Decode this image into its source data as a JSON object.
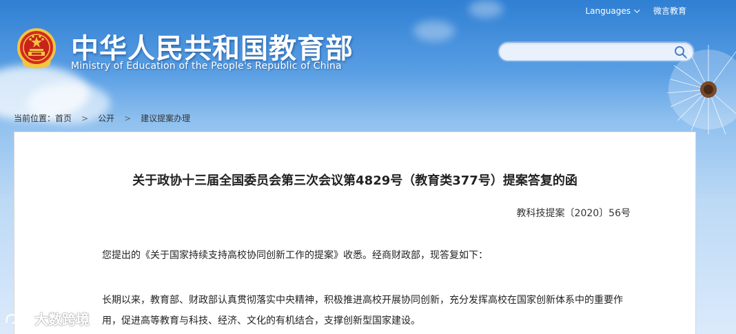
{
  "top_links": {
    "languages": "Languages",
    "weibo": "微言教育"
  },
  "header": {
    "title_cn": "中华人民共和国教育部",
    "title_en": "Ministry of Education of the People's Republic of China"
  },
  "search": {
    "placeholder": "",
    "value": ""
  },
  "breadcrumb": {
    "prefix": "当前位置：",
    "items": [
      "首页",
      "公开",
      "建议提案办理"
    ],
    "separator": ">"
  },
  "document": {
    "title": "关于政协十三届全国委员会第三次会议第4829号（教育类377号）提案答复的函",
    "number": "教科技提案〔2020〕56号",
    "paragraphs": [
      "您提出的《关于国家持续支持高校协同创新工作的提案》收悉。经商财政部，现答复如下：",
      "长期以来，教育部、财政部认真贯彻落实中央精神，积极推进高校开展协同创新，充分发挥高校在国家创新体系中的重要作用，促进高等教育与科技、经济、文化的有机结合，支撑创新型国家建设。"
    ]
  },
  "watermark": {
    "text": "大数跨境"
  },
  "colors": {
    "sky_top": "#2f7fd3",
    "sky_bottom": "#dbeafb",
    "emblem_red": "#d62a1e",
    "emblem_gold": "#f3c540"
  }
}
